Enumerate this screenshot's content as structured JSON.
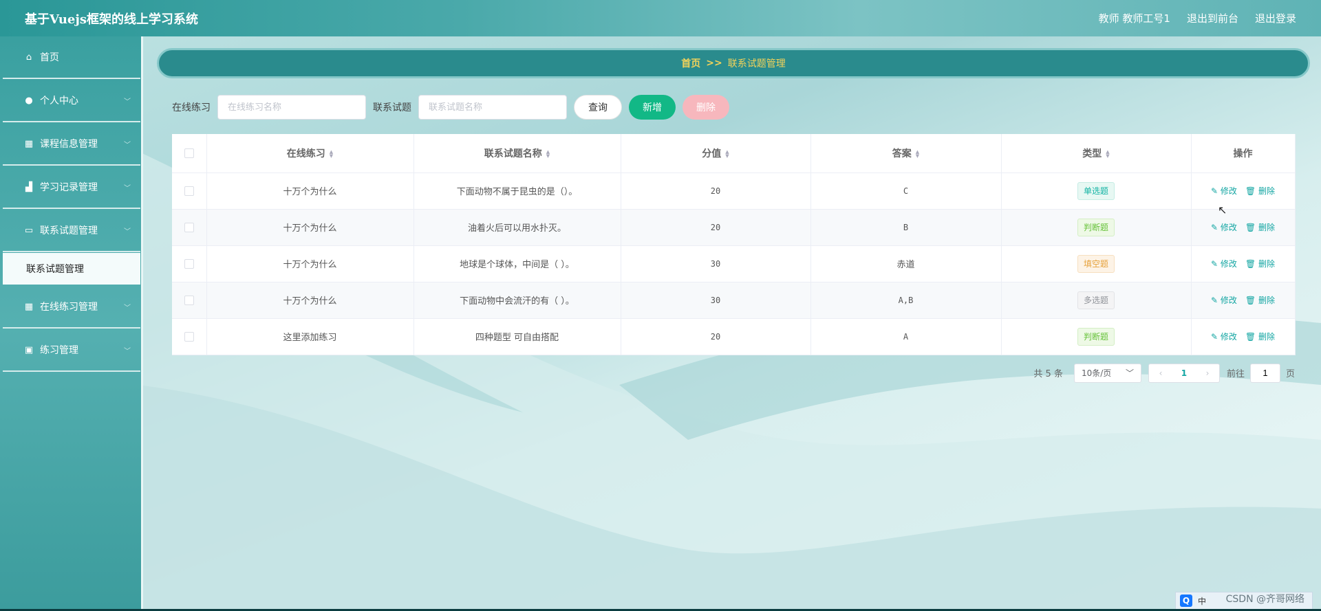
{
  "header": {
    "title": "基于Vuejs框架的线上学习系统",
    "user": "教师 教师工号1",
    "to_front": "退出到前台",
    "logout": "退出登录"
  },
  "sidebar": {
    "items": [
      {
        "label": "首页",
        "icon": "home-icon"
      },
      {
        "label": "个人中心",
        "icon": "user-icon"
      },
      {
        "label": "课程信息管理",
        "icon": "grid-icon"
      },
      {
        "label": "学习记录管理",
        "icon": "chart-icon"
      },
      {
        "label": "联系试题管理",
        "icon": "monitor-icon"
      },
      {
        "label": "在线练习管理",
        "icon": "grid-icon"
      },
      {
        "label": "练习管理",
        "icon": "clipboard-icon"
      }
    ],
    "submenu_active": "联系试题管理"
  },
  "breadcrumb": {
    "home": "首页",
    "sep": ">>",
    "current": "联系试题管理"
  },
  "search": {
    "label1": "在线练习",
    "placeholder1": "在线练习名称",
    "label2": "联系试题",
    "placeholder2": "联系试题名称",
    "query": "查询",
    "add": "新增",
    "delete": "删除"
  },
  "table": {
    "columns": [
      "在线练习",
      "联系试题名称",
      "分值",
      "答案",
      "类型",
      "操作"
    ],
    "rows": [
      {
        "practice": "十万个为什么",
        "name": "下面动物不属于昆虫的是（）。",
        "score": "20",
        "answer": "C",
        "type": "单选题",
        "tag": "single"
      },
      {
        "practice": "十万个为什么",
        "name": "油着火后可以用水扑灭。",
        "score": "20",
        "answer": "B",
        "type": "判断题",
        "tag": "tf"
      },
      {
        "practice": "十万个为什么",
        "name": "地球是个球体，中间是（ ）。",
        "score": "30",
        "answer": "赤道",
        "type": "填空题",
        "tag": "fill"
      },
      {
        "practice": "十万个为什么",
        "name": "下面动物中会流汗的有（ ）。",
        "score": "30",
        "answer": "A,B",
        "type": "多选题",
        "tag": "multi"
      },
      {
        "practice": "这里添加练习",
        "name": "四种题型 可自由搭配",
        "score": "20",
        "answer": "A",
        "type": "判断题",
        "tag": "tf"
      }
    ],
    "edit": "修改",
    "del": "删除"
  },
  "pagination": {
    "total": "共 5 条",
    "page_size": "10条/页",
    "current": "1",
    "goto_prefix": "前往",
    "goto_value": "1",
    "goto_suffix": "页"
  },
  "tray": {
    "text": "中"
  },
  "watermark": "CSDN @齐哥网络"
}
